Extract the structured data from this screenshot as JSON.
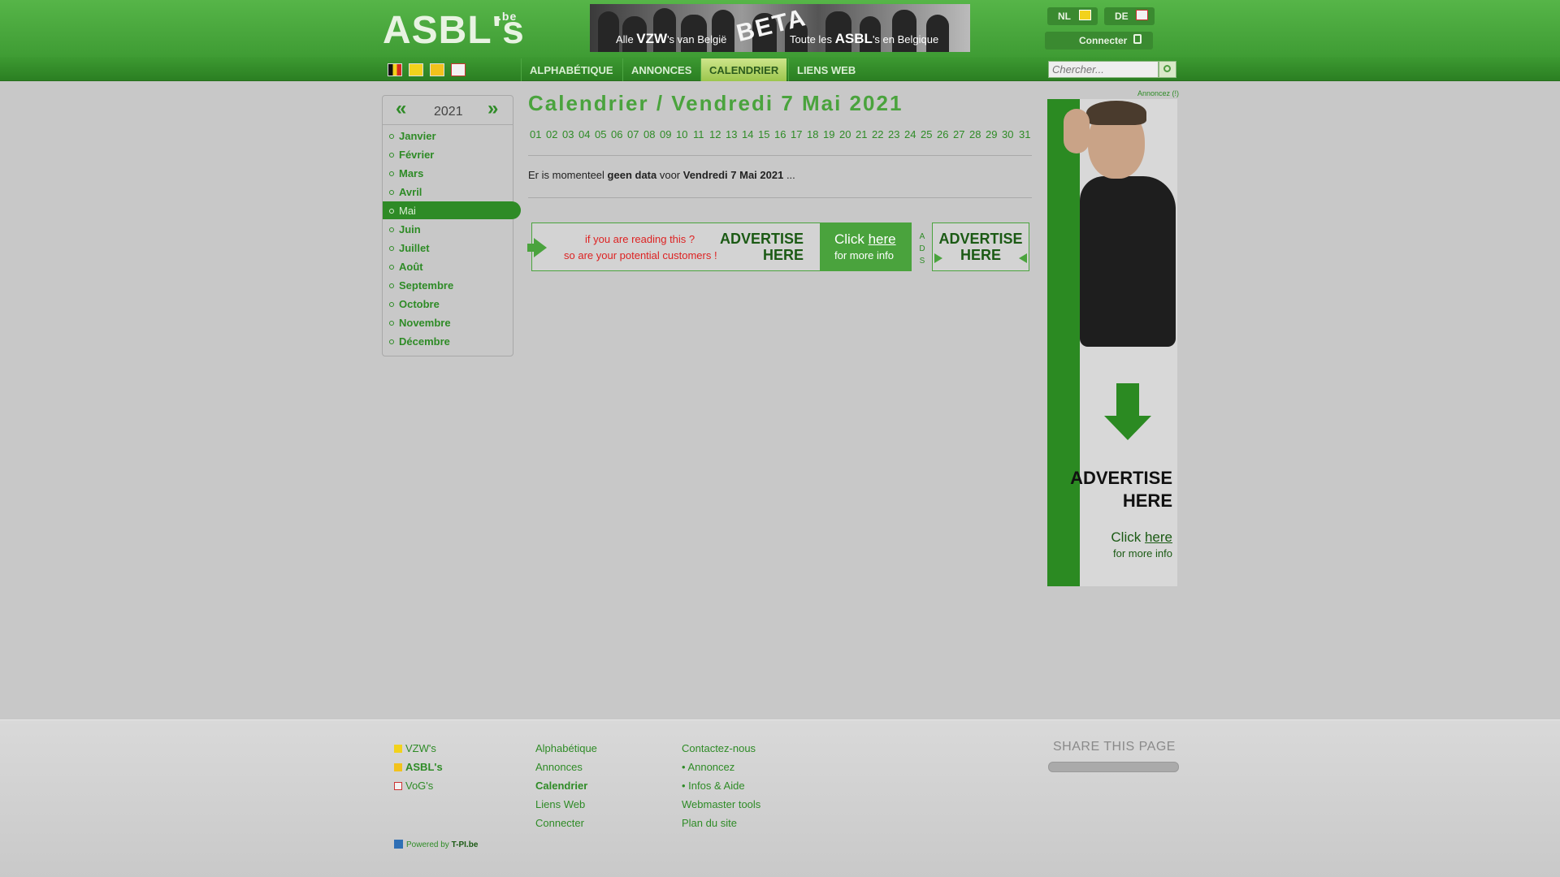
{
  "header": {
    "logo_text": "ASBL's",
    "logo_suffix": ".be",
    "banner": {
      "left_prefix": "Alle ",
      "left_brand": "VZW",
      "left_suffix": "'s van België",
      "beta": "BETA",
      "right_prefix": "Toute les ",
      "right_brand": "ASBL",
      "right_suffix": "'s en Belgique"
    },
    "lang_nl": "NL",
    "lang_de": "DE",
    "connect_label": "Connecter"
  },
  "nav": {
    "items": [
      "ALPHABÉTIQUE",
      "ANNONCES",
      "CALENDRIER",
      "LIENS WEB"
    ],
    "active": "CALENDRIER",
    "search_placeholder": "Chercher..."
  },
  "sidebar": {
    "prev": "«",
    "next": "»",
    "year": "2021",
    "months": [
      "Janvier",
      "Février",
      "Mars",
      "Avril",
      "Mai",
      "Juin",
      "Juillet",
      "Août",
      "Septembre",
      "Octobre",
      "Novembre",
      "Décembre"
    ],
    "active_month": "Mai"
  },
  "main": {
    "title": "Calendrier / Vendredi 7 Mai 2021",
    "days": [
      "01",
      "02",
      "03",
      "04",
      "05",
      "06",
      "07",
      "08",
      "09",
      "10",
      "11",
      "12",
      "13",
      "14",
      "15",
      "16",
      "17",
      "18",
      "19",
      "20",
      "21",
      "22",
      "23",
      "24",
      "25",
      "26",
      "27",
      "28",
      "29",
      "30",
      "31"
    ],
    "nodata_prefix": "Er is momenteel ",
    "nodata_bold": "geen data",
    "nodata_mid": " voor ",
    "nodata_date": "Vendredi 7 Mai 2021",
    "nodata_suffix": " ..."
  },
  "ads": {
    "wide_line1": "if you are reading this ?",
    "wide_line2": "so are your potential customers !",
    "advertise": "ADVERTISE",
    "here": "HERE",
    "click_prefix": "Click ",
    "click_link": "here",
    "more_info": "for more info",
    "ads_label": [
      "A",
      "D",
      "S"
    ],
    "annoncez": "Annoncez (!)"
  },
  "footer": {
    "col1": [
      "VZW's",
      "ASBL's",
      "VoG's"
    ],
    "col2": [
      "Alphabétique",
      "Annonces",
      "Calendrier",
      "Liens Web",
      "Connecter"
    ],
    "col3": [
      "Contactez-nous",
      "• Annoncez",
      "• Infos & Aide",
      "Webmaster tools",
      "Plan du site"
    ],
    "share_title": "SHARE THIS PAGE",
    "powered_prefix": "Powered by ",
    "powered_brand": "T-PI.be"
  }
}
